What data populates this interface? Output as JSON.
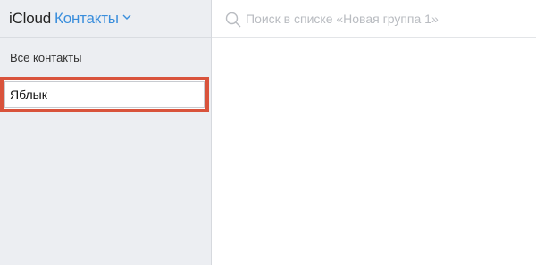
{
  "header": {
    "brand": "iCloud",
    "section": "Контакты"
  },
  "sidebar": {
    "groups": [
      {
        "label": "Все контакты"
      }
    ],
    "rename_input": {
      "value": "Яблык"
    }
  },
  "search": {
    "placeholder": "Поиск в списке «Новая группа 1»"
  },
  "colors": {
    "accent": "#3a8edc",
    "highlight_frame": "#d9533c",
    "sidebar_bg": "#eceef2"
  }
}
